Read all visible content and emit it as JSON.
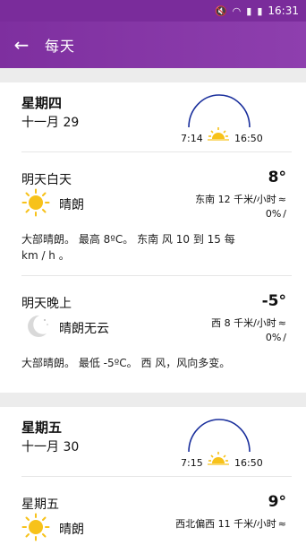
{
  "status": {
    "time": "16:31"
  },
  "appbar": {
    "title": "每天"
  },
  "days": [
    {
      "name": "星期四",
      "date": "十一月 29",
      "sunrise": "7:14",
      "sunset": "16:50",
      "day": {
        "label": "明天白天",
        "condition": "晴朗",
        "temp": "8°",
        "wind": "东南 12 千米/小时",
        "precip": "0%",
        "desc": "大部晴朗。 最高 8ºC。 东南 风 10 到 15 每 km / h 。"
      },
      "night": {
        "label": "明天晚上",
        "condition": "晴朗无云",
        "temp": "-5°",
        "wind": "西 8 千米/小时",
        "precip": "0%",
        "desc": "大部晴朗。 最低 -5ºC。 西 风，风向多变。"
      }
    },
    {
      "name": "星期五",
      "date": "十一月 30",
      "sunrise": "7:15",
      "sunset": "16:50",
      "day": {
        "label": "星期五",
        "condition": "晴朗",
        "temp": "9°",
        "wind": "西北偏西 11 千米/小时"
      }
    }
  ]
}
